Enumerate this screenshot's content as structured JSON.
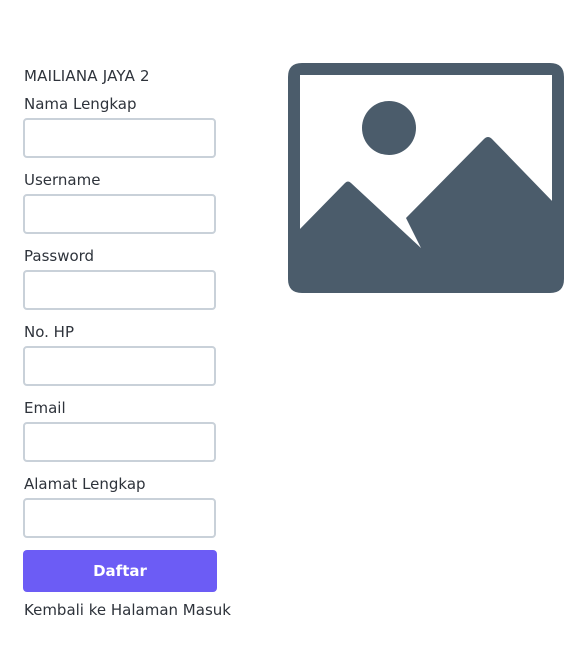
{
  "brand": {
    "name": "MAILIANA JAYA 2"
  },
  "form": {
    "fields": [
      {
        "label": "Nama Lengkap",
        "value": ""
      },
      {
        "label": "Username",
        "value": ""
      },
      {
        "label": "Password",
        "value": ""
      },
      {
        "label": "No. HP",
        "value": ""
      },
      {
        "label": "Email",
        "value": ""
      },
      {
        "label": "Alamat Lengkap",
        "value": ""
      }
    ],
    "submit_label": "Daftar",
    "back_link_label": "Kembali ke Halaman Masuk"
  },
  "illustration": {
    "icon": "image-placeholder-icon",
    "color": "#4b5c6b"
  },
  "colors": {
    "accent": "#6c5cf5",
    "input_border": "#c9d1d9",
    "text": "#2e333b"
  }
}
